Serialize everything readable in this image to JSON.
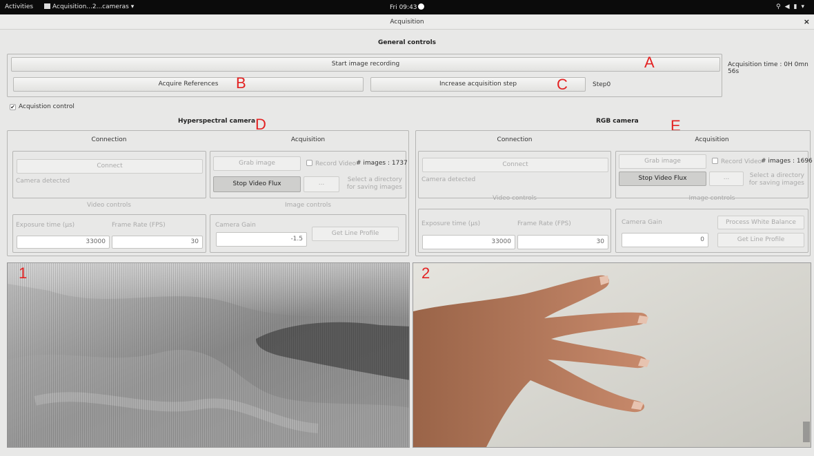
{
  "system_bar": {
    "activities": "Activities",
    "app_menu": "Acquisition...2...cameras ▾",
    "clock": "Fri 09:43",
    "status_icons": [
      "wifi-icon",
      "volume-icon",
      "battery-icon",
      "chevron-down-icon"
    ]
  },
  "window": {
    "title": "Acquisition",
    "close": "×"
  },
  "general": {
    "title": "General controls",
    "start_recording": "Start image recording",
    "acquisition_time": "Acquisition time : 0H 0mn 56s",
    "acquire_references": "Acquire References",
    "increase_step": "Increase acquisition step",
    "step": "Step0"
  },
  "acquisition_control": {
    "label": "Acquistion control",
    "checked": true
  },
  "hyperspectral": {
    "title": "Hyperspectral camera",
    "connection_title": "Connection",
    "connect": "Connect",
    "status": "Camera detected",
    "acquisition_title": "Acquisition",
    "grab_image": "Grab image",
    "record_video": "Record Video",
    "images_count": "# images : 1737",
    "stop_video": "Stop Video Flux",
    "browse": "...",
    "directory_hint_1": "Select a directory",
    "directory_hint_2": "for saving images",
    "video_controls_title": "Video controls",
    "image_controls_title": "Image controls",
    "exposure_label": "Exposure time (µs)",
    "framerate_label": "Frame Rate (FPS)",
    "exposure_value": "33000",
    "framerate_value": "30",
    "gain_label": "Camera Gain",
    "gain_value": "-1.5",
    "line_profile": "Get Line Profile"
  },
  "rgb": {
    "title": "RGB camera",
    "connection_title": "Connection",
    "connect": "Connect",
    "status": "Camera detected",
    "acquisition_title": "Acquisition",
    "grab_image": "Grab image",
    "record_video": "Record Video",
    "images_count": "# images : 1696",
    "stop_video": "Stop Video Flux",
    "browse": "...",
    "directory_hint_1": "Select a directory",
    "directory_hint_2": "for saving images",
    "video_controls_title": "Video controls",
    "image_controls_title": "Image controls",
    "exposure_label": "Exposure time (µs)",
    "framerate_label": "Frame Rate (FPS)",
    "exposure_value": "33000",
    "framerate_value": "30",
    "gain_label": "Camera Gain",
    "gain_value": "0",
    "white_balance": "Process White Balance",
    "line_profile": "Get Line Profile"
  },
  "annotations": {
    "A": "A",
    "B": "B",
    "C": "C",
    "D": "D",
    "E": "E",
    "view1": "1",
    "view2": "2"
  },
  "colors": {
    "annotation": "#e32222",
    "background": "#e8e8e7",
    "topbar": "#0b0b0b"
  }
}
